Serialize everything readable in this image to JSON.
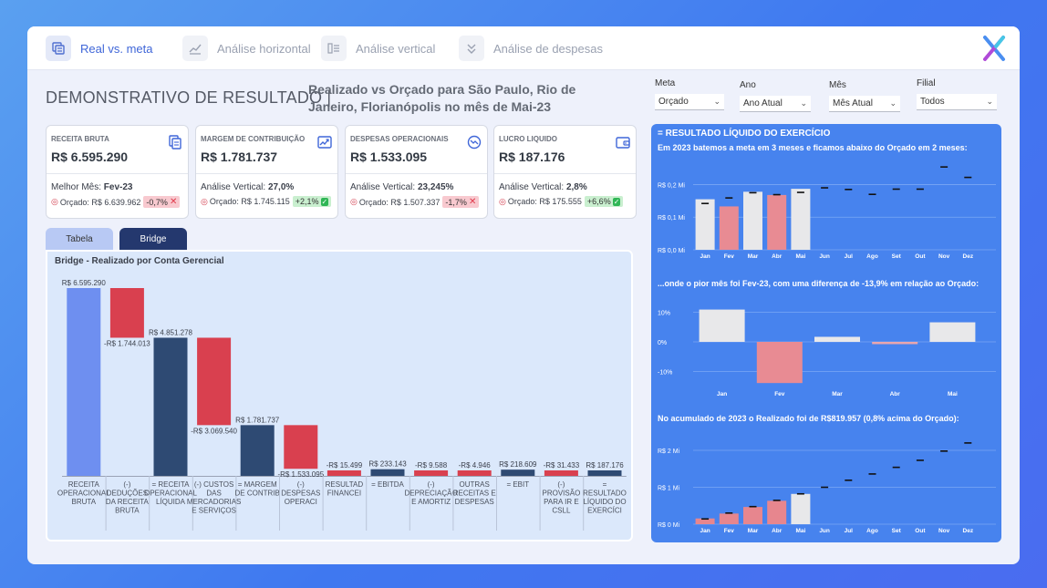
{
  "nav": [
    {
      "label": "Real vs. meta",
      "icon": "table-icon",
      "active": true
    },
    {
      "label": "Análise horizontal",
      "icon": "trend-chart-icon",
      "active": false
    },
    {
      "label": "Análise vertical",
      "icon": "list-icon",
      "active": false
    },
    {
      "label": "Análise de despesas",
      "icon": "chevron-double-icon",
      "active": false
    }
  ],
  "header": {
    "title": "DEMONSTRATIVO DE RESULTADO |",
    "subtitle": "Realizado vs Orçado para São Paulo, Rio de Janeiro, Florianópolis no mês de Mai-23"
  },
  "filters": [
    {
      "label": "Meta",
      "value": "Orçado"
    },
    {
      "label": "Ano",
      "value": "Ano Atual"
    },
    {
      "label": "Mês",
      "value": "Mês Atual"
    },
    {
      "label": "Filial",
      "value": "Todos"
    }
  ],
  "kpis": [
    {
      "label": "RECEITA BRUTA",
      "value": "R$ 6.595.290",
      "line1_label": "Melhor Mês:",
      "line1_value": "Fev-23",
      "orcado": "Orçado: R$ 6.639.962",
      "variance": "-0,7%",
      "status": "neg",
      "icon": "document-copy-icon"
    },
    {
      "label": "MARGEM DE CONTRIBUIÇÃO",
      "value": "R$ 1.781.737",
      "line1_label": "Análise Vertical:",
      "line1_value": "27,0%",
      "orcado": "Orçado: R$ 1.745.115",
      "variance": "+2,1%",
      "status": "pos",
      "icon": "trend-up-icon"
    },
    {
      "label": "DESPESAS OPERACIONAIS",
      "value": "R$ 1.533.095",
      "line1_label": "Análise Vertical:",
      "line1_value": "23,245%",
      "orcado": "Orçado: R$ 1.507.337",
      "variance": "-1,7%",
      "status": "neg",
      "icon": "trend-down-circle-icon"
    },
    {
      "label": "LUCRO LIQUIDO",
      "value": "R$ 187.176",
      "line1_label": "Análise Vertical:",
      "line1_value": "2,8%",
      "orcado": "Orçado: R$ 175.555",
      "variance": "+6,6%",
      "status": "pos",
      "icon": "wallet-icon"
    }
  ],
  "tabs": {
    "tabela": "Tabela",
    "bridge": "Bridge"
  },
  "colors": {
    "accent": "#3f66d8",
    "navy": "#2e4a73",
    "start": "#6e8ff0",
    "negative": "#d9404f",
    "positive_mark": "#2fb655",
    "panel_blue": "#4783ee",
    "highlight_red": "#e88b93",
    "neutral_bar": "#e8e8ea"
  },
  "chart_data": [
    {
      "type": "bar",
      "title": "Bridge - Realizado por Conta Gerencial",
      "subtype": "waterfall",
      "categories": [
        "RECEITA OPERACIONAL BRUTA",
        "(-) DEDUÇÕES DA RECEITA BRUTA",
        "= RECEITA OPERACIONAL LÍQUIDA",
        "(-) CUSTOS DAS MERCADORIAS E SERVIÇOS",
        "= MARGEM DE CONTRIB",
        "(-) DESPESAS OPERACI",
        "RESULTAD FINANCEI",
        "= EBITDA",
        "(-) DEPRECIAÇÃO E AMORTIZ",
        "OUTRAS RECEITAS E DESPESAS",
        "= EBIT",
        "(-) PROVISÃO PARA IR E CSLL",
        "= RESULTADO LÍQUIDO DO EXERCÍCI"
      ],
      "values": [
        6595290,
        -1744013,
        4851278,
        -3069540,
        1781737,
        -1533095,
        -15499,
        233143,
        -9588,
        -4946,
        218609,
        -31433,
        187176
      ],
      "kinds": [
        "start",
        "neg",
        "total",
        "neg",
        "total",
        "neg",
        "neg",
        "total",
        "neg",
        "neg",
        "total",
        "neg",
        "total"
      ],
      "labels": [
        "R$ 6.595.290",
        "-R$ 1.744.013",
        "R$ 4.851.278",
        "-R$ 3.069.540",
        "R$ 1.781.737",
        "-R$ 1.533.095",
        "-R$ 15.499",
        "R$ 233.143",
        "-R$ 9.588",
        "-R$ 4.946",
        "R$ 218.609",
        "-R$ 31.433",
        "R$ 187.176"
      ],
      "ylim": [
        0,
        7000000
      ]
    },
    {
      "type": "bar",
      "title": "= RESULTADO LÍQUIDO DO EXERCÍCIO",
      "caption": "Em 2023 batemos a meta em 3 meses e ficamos abaixo do Orçado em 2 meses:",
      "categories": [
        "Jan",
        "Fev",
        "Mar",
        "Abr",
        "Mai",
        "Jun",
        "Jul",
        "Ago",
        "Set",
        "Out",
        "Nov",
        "Dez"
      ],
      "series": [
        {
          "name": "Realizado",
          "values": [
            0.155,
            0.133,
            0.178,
            0.168,
            0.187,
            null,
            null,
            null,
            null,
            null,
            null,
            null
          ]
        },
        {
          "name": "Orçado",
          "values": [
            0.142,
            0.159,
            0.175,
            0.169,
            0.176,
            0.19,
            0.185,
            0.17,
            0.186,
            0.186,
            0.254,
            0.222
          ]
        }
      ],
      "highlight": [
        false,
        true,
        false,
        true,
        false
      ],
      "yticks": [
        "R$ 0,0 Mi",
        "R$ 0,1 Mi",
        "R$ 0,2 Mi"
      ],
      "ylim": [
        0,
        0.26
      ]
    },
    {
      "type": "bar",
      "caption": "...onde o pior mês foi Fev-23, com uma diferença de -13,9% em relação ao Orçado:",
      "categories": [
        "Jan",
        "Fev",
        "Mar",
        "Abr",
        "Mai"
      ],
      "values": [
        10.9,
        -13.9,
        1.7,
        -0.6,
        6.6
      ],
      "yticks": [
        "10%",
        "0%",
        "-10%"
      ],
      "ylim": [
        -15,
        15
      ]
    },
    {
      "type": "bar",
      "caption": "No acumulado de 2023 o Realizado foi de R$819.957 (0,8% acima do Orçado):",
      "categories": [
        "Jan",
        "Fev",
        "Mar",
        "Abr",
        "Mai",
        "Jun",
        "Jul",
        "Ago",
        "Set",
        "Out",
        "Nov",
        "Dez"
      ],
      "series": [
        {
          "name": "Realizado",
          "values": [
            0.155,
            0.288,
            0.466,
            0.634,
            0.82,
            null,
            null,
            null,
            null,
            null,
            null,
            null
          ]
        },
        {
          "name": "Orçado",
          "values": [
            0.142,
            0.301,
            0.476,
            0.645,
            0.821,
            1.0,
            1.19,
            1.36,
            1.54,
            1.73,
            1.98,
            2.2
          ]
        }
      ],
      "yticks": [
        "R$ 0 Mi",
        "R$ 1 Mi",
        "R$ 2 Mi"
      ],
      "ylim": [
        0,
        2.35
      ]
    }
  ]
}
